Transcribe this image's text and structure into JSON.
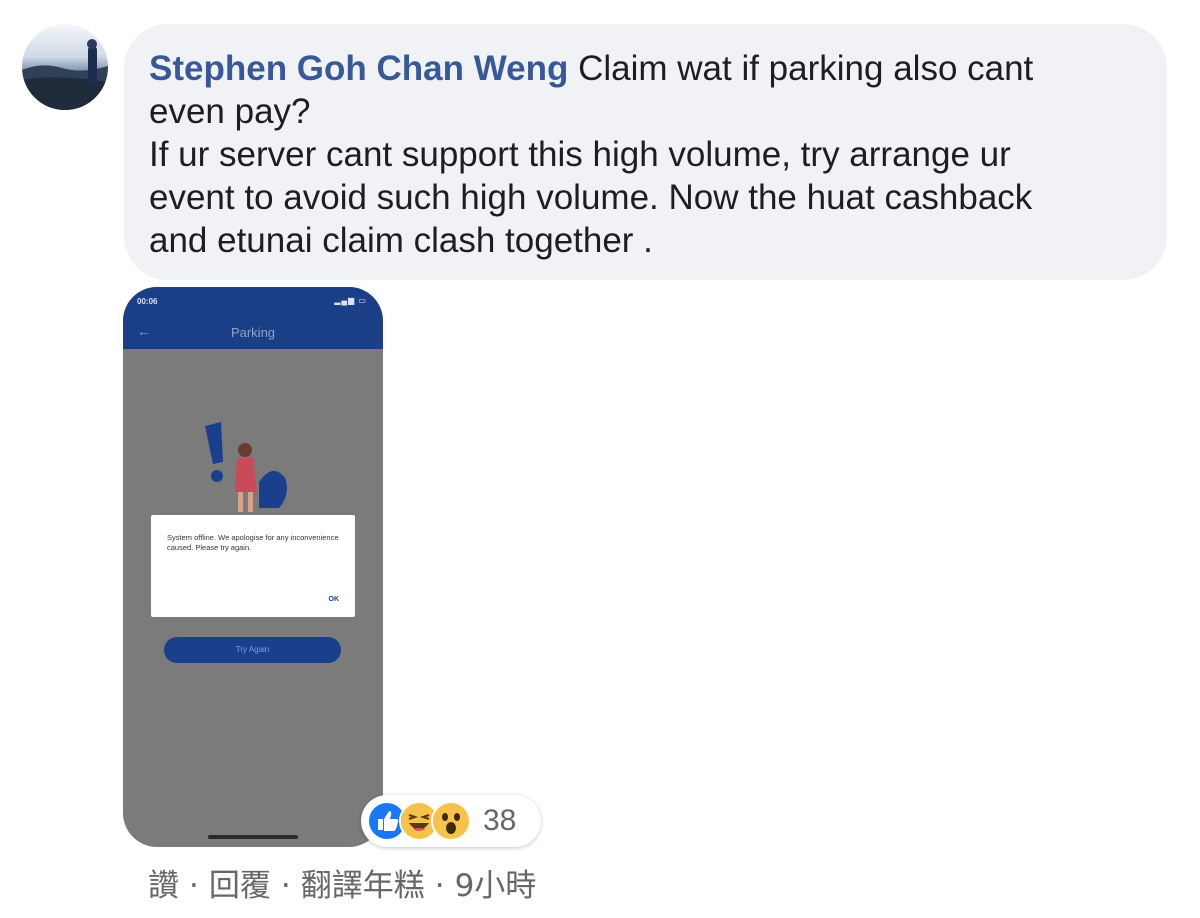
{
  "comment": {
    "author": "Stephen Goh Chan Weng",
    "text_lines": [
      "Claim wat if parking also cant",
      "even pay?",
      "If ur server cant support this high volume, try arrange ur",
      "event to avoid such high volume. Now the huat cashback",
      "and etunai claim clash together ."
    ]
  },
  "attachment": {
    "status_time": "00:06",
    "screen_title": "Parking",
    "dialog_message": "System offline. We apologise for any inconvenience caused. Please try again.",
    "dialog_ok": "OK",
    "retry_button": "Try Again"
  },
  "reactions": {
    "icons": [
      "like-icon",
      "haha-icon",
      "wow-icon"
    ],
    "count": "38",
    "colors": {
      "like": "#1877f2",
      "emoji": "#f7c24a"
    }
  },
  "actions": {
    "like": "讚",
    "reply": "回覆",
    "translate": "翻譯年糕",
    "separator": "·",
    "timestamp": "9小時"
  },
  "colors": {
    "author": "#385898",
    "bubble": "#f0f2f5",
    "meta_text": "#65676b"
  }
}
